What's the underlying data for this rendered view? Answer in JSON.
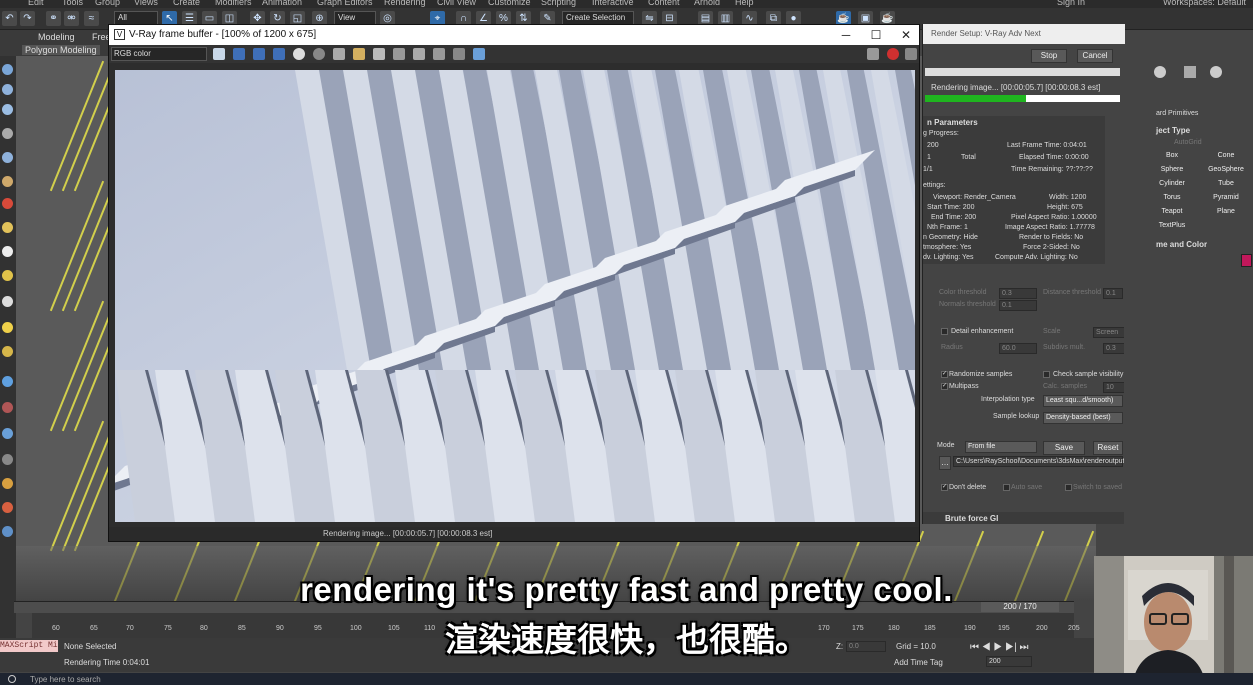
{
  "menubar": {
    "items": [
      "Edit",
      "Tools",
      "Group",
      "Views",
      "Create",
      "Modifiers",
      "Animation",
      "Graph Editors",
      "Rendering",
      "Civil View",
      "Customize",
      "Scripting",
      "Interactive",
      "Content",
      "Arnold",
      "Help"
    ],
    "sign_in": "Sign In",
    "workspaces": "Workspaces:",
    "workspace_value": "Default"
  },
  "toolbar": {
    "filter_value": "All",
    "view_value": "View",
    "selection_set_placeholder": "Create Selection Se"
  },
  "ribbon": {
    "tab_modeling": "Modeling",
    "tab_freeform": "Free",
    "panel_label": "Polygon Modeling"
  },
  "frame_buffer": {
    "title": "V-Ray frame buffer - [100% of 1200 x 675]",
    "channel": "RGB color",
    "status_text": "Rendering image... [00:00:05.7] [00:00:08.3 est]",
    "render_colors": {
      "sky": "#c8d2e6",
      "step_light": "#eceff5",
      "step_shadow": "#6f7890",
      "riser": "#9aa3b8"
    }
  },
  "render_setup": {
    "title": "Render Setup: V-Ray Adv Next",
    "stop_label": "Stop",
    "cancel_label": "Cancel",
    "status_label": "Rendering image... [00:00:05.7] [00:00:08.3 est]",
    "progress_fraction": 0.52,
    "progress_color": "#1fb51f",
    "section_params": "n Parameters",
    "render_progress_label": "g Progress:",
    "frame_value": "200",
    "total_label": "Total",
    "count_1": "1",
    "count_2": "1/1",
    "last_frame_time": "Last Frame Time:  0:04:01",
    "elapsed_time": "Elapsed Time:  0:00:00",
    "time_remaining": "Time Remaining:  ??:??:??",
    "settings_label": "ettings:",
    "viewport": "Viewport:  Render_Camera",
    "start_time": "Start Time:  200",
    "end_time": "End Time:  200",
    "nth_frame": "Nth Frame:  1",
    "hidden_geometry": "n Geometry:  Hide",
    "atmospherics": "tmosphere:  Yes",
    "adv_lighting": "dv. Lighting:  Yes",
    "width": "Width:  1200",
    "height": "Height:  675",
    "pixel_aspect": "Pixel Aspect Ratio:  1.00000",
    "image_aspect": "Image Aspect Ratio:  1.77778",
    "render_to_fields": "Render to Fields:  No",
    "force_2sided": "Force 2-Sided:  No",
    "compute_adv": "Compute Adv. Lighting:  No",
    "color_threshold_label": "Color threshold",
    "color_threshold_value": "0.3",
    "distance_threshold_label": "Distance threshold",
    "distance_threshold_value": "0.1",
    "normals_threshold_label": "Normals threshold",
    "normals_threshold_value": "0.1",
    "detail_enhancement_label": "Detail enhancement",
    "scale_label": "Scale",
    "scale_value": "Screen",
    "radius_label": "Radius",
    "radius_value": "60.0",
    "subdivs_mult_label": "Subdivs mult.",
    "subdivs_mult_value": "0.3",
    "randomize_label": "Randomize samples",
    "check_visibility_label": "Check sample visibility",
    "multipass_label": "Multipass",
    "calc_samples_label": "Calc. samples",
    "calc_samples_value": "10",
    "interp_label": "Interpolation type",
    "interp_value": "Least squ...d/smooth)",
    "lookup_label": "Sample lookup",
    "lookup_value": "Density-based (best)",
    "mode_label": "Mode",
    "mode_value": "From file",
    "save_label": "Save",
    "reset_label": "Reset",
    "path": "C:\\Users\\RaySchool\\Documents\\3dsMax\\renderoutput\\I",
    "dont_delete_label": "Don't delete",
    "auto_save_label": "Auto save",
    "switch_saved_label": "Switch to saved map",
    "brute_force_label": "Brute force GI"
  },
  "command_panel": {
    "category": "ard Primitives",
    "object_type": "ject Type",
    "autogrid": "AutoGrid",
    "primitives": [
      "Box",
      "Cone",
      "Sphere",
      "GeoSphere",
      "Cylinder",
      "Tube",
      "Torus",
      "Pyramid",
      "Teapot",
      "Plane",
      "TextPlus"
    ],
    "name_color": "me and Color",
    "swatch_color": "#c2185b"
  },
  "subtitles": {
    "english": "rendering it's pretty fast and pretty cool.",
    "chinese": "渲染速度很快，也很酷。"
  },
  "timeline": {
    "frame_counter": "200 / 170",
    "ticks": [
      "60",
      "65",
      "70",
      "75",
      "80",
      "85",
      "90",
      "95",
      "100",
      "105",
      "110",
      "170",
      "175",
      "180",
      "185",
      "190",
      "195",
      "200",
      "205"
    ]
  },
  "statusbar": {
    "script_label": "MAXScript Mi",
    "selection": "None Selected",
    "render_time": "Rendering Time  0:04:01",
    "z_label": "Z:",
    "z_value": "0.0",
    "grid": "Grid = 10.0",
    "add_time_tag": "Add Time Tag",
    "frame_spinner": "200"
  },
  "taskbar": {
    "search_placeholder": "Type here to search"
  }
}
